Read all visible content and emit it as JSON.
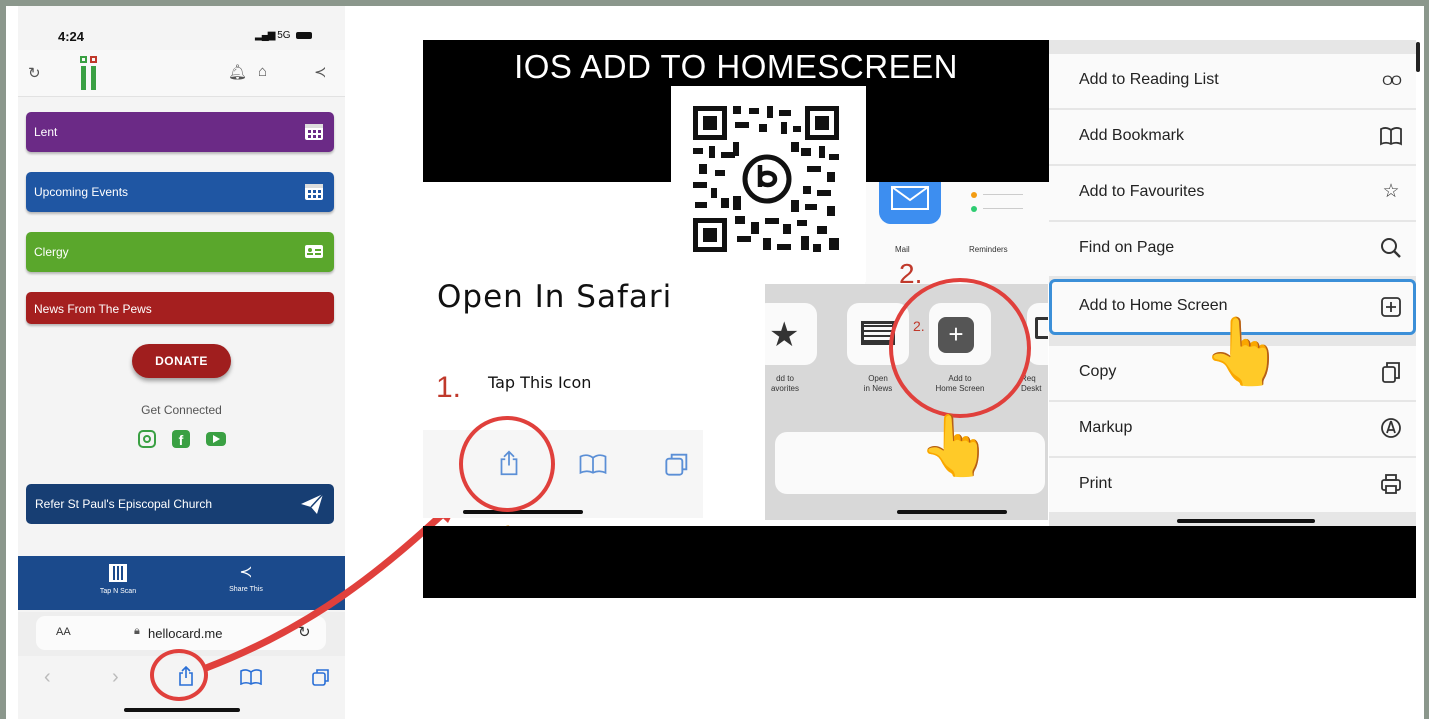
{
  "phone": {
    "time": "4:24",
    "signal": "5G",
    "menu_items": [
      {
        "label": "Lent",
        "color": "#6b2a86",
        "icon": "calendar-icon"
      },
      {
        "label": "Upcoming Events",
        "color": "#1f56a3",
        "icon": "calendar-icon"
      },
      {
        "label": "Clergy",
        "color": "#5aa72c",
        "icon": "id-card-icon"
      },
      {
        "label": "News From The Pews",
        "color": "#a51f1f",
        "icon": ""
      }
    ],
    "donate_label": "DONATE",
    "get_connected": "Get Connected",
    "refer_label": "Refer St Paul's Episcopal Church",
    "bottom_bar": {
      "tap_n_scan": "Tap N Scan",
      "share_this": "Share This"
    },
    "url_bar": {
      "aa": "AA",
      "url": "hellocard.me"
    },
    "colors": {
      "instagram": "#3aa043",
      "facebook": "#3aa043",
      "youtube": "#3aa043"
    }
  },
  "tutorial": {
    "title": "IOS ADD TO HOMESCREEN",
    "open_in_safari": "Open In Safari",
    "step1_number": "1.",
    "step1_text": "Tap This Icon",
    "step2_number": "2.",
    "step2_small": "2.",
    "share_sheet_top": [
      {
        "label": "Mail",
        "icon": "mail-icon"
      },
      {
        "label": "Reminders",
        "icon": "reminders-icon"
      }
    ],
    "share_sheet_actions": [
      {
        "label": "dd to\navorites",
        "icon": "star-icon"
      },
      {
        "label": "Open\nin News",
        "icon": "news-icon"
      },
      {
        "label": "Add to\nHome Screen",
        "icon": "plus-icon"
      },
      {
        "label": "Req\nDeskt",
        "icon": "desktop-icon"
      }
    ],
    "menu": [
      {
        "label": "Add to Reading List",
        "icon": "reading-glasses-icon"
      },
      {
        "label": "Add Bookmark",
        "icon": "book-icon"
      },
      {
        "label": "Add to Favourites",
        "icon": "star-icon"
      },
      {
        "label": "Find on Page",
        "icon": "search-icon"
      },
      {
        "label": "Add to Home Screen",
        "icon": "plus-square-icon",
        "highlighted": true
      },
      {
        "label": "Copy",
        "icon": "copy-icon"
      },
      {
        "label": "Markup",
        "icon": "markup-icon"
      },
      {
        "label": "Print",
        "icon": "print-icon"
      }
    ],
    "colors": {
      "annotation_red": "#e0403c",
      "highlight_blue": "#3b8fd8"
    }
  }
}
